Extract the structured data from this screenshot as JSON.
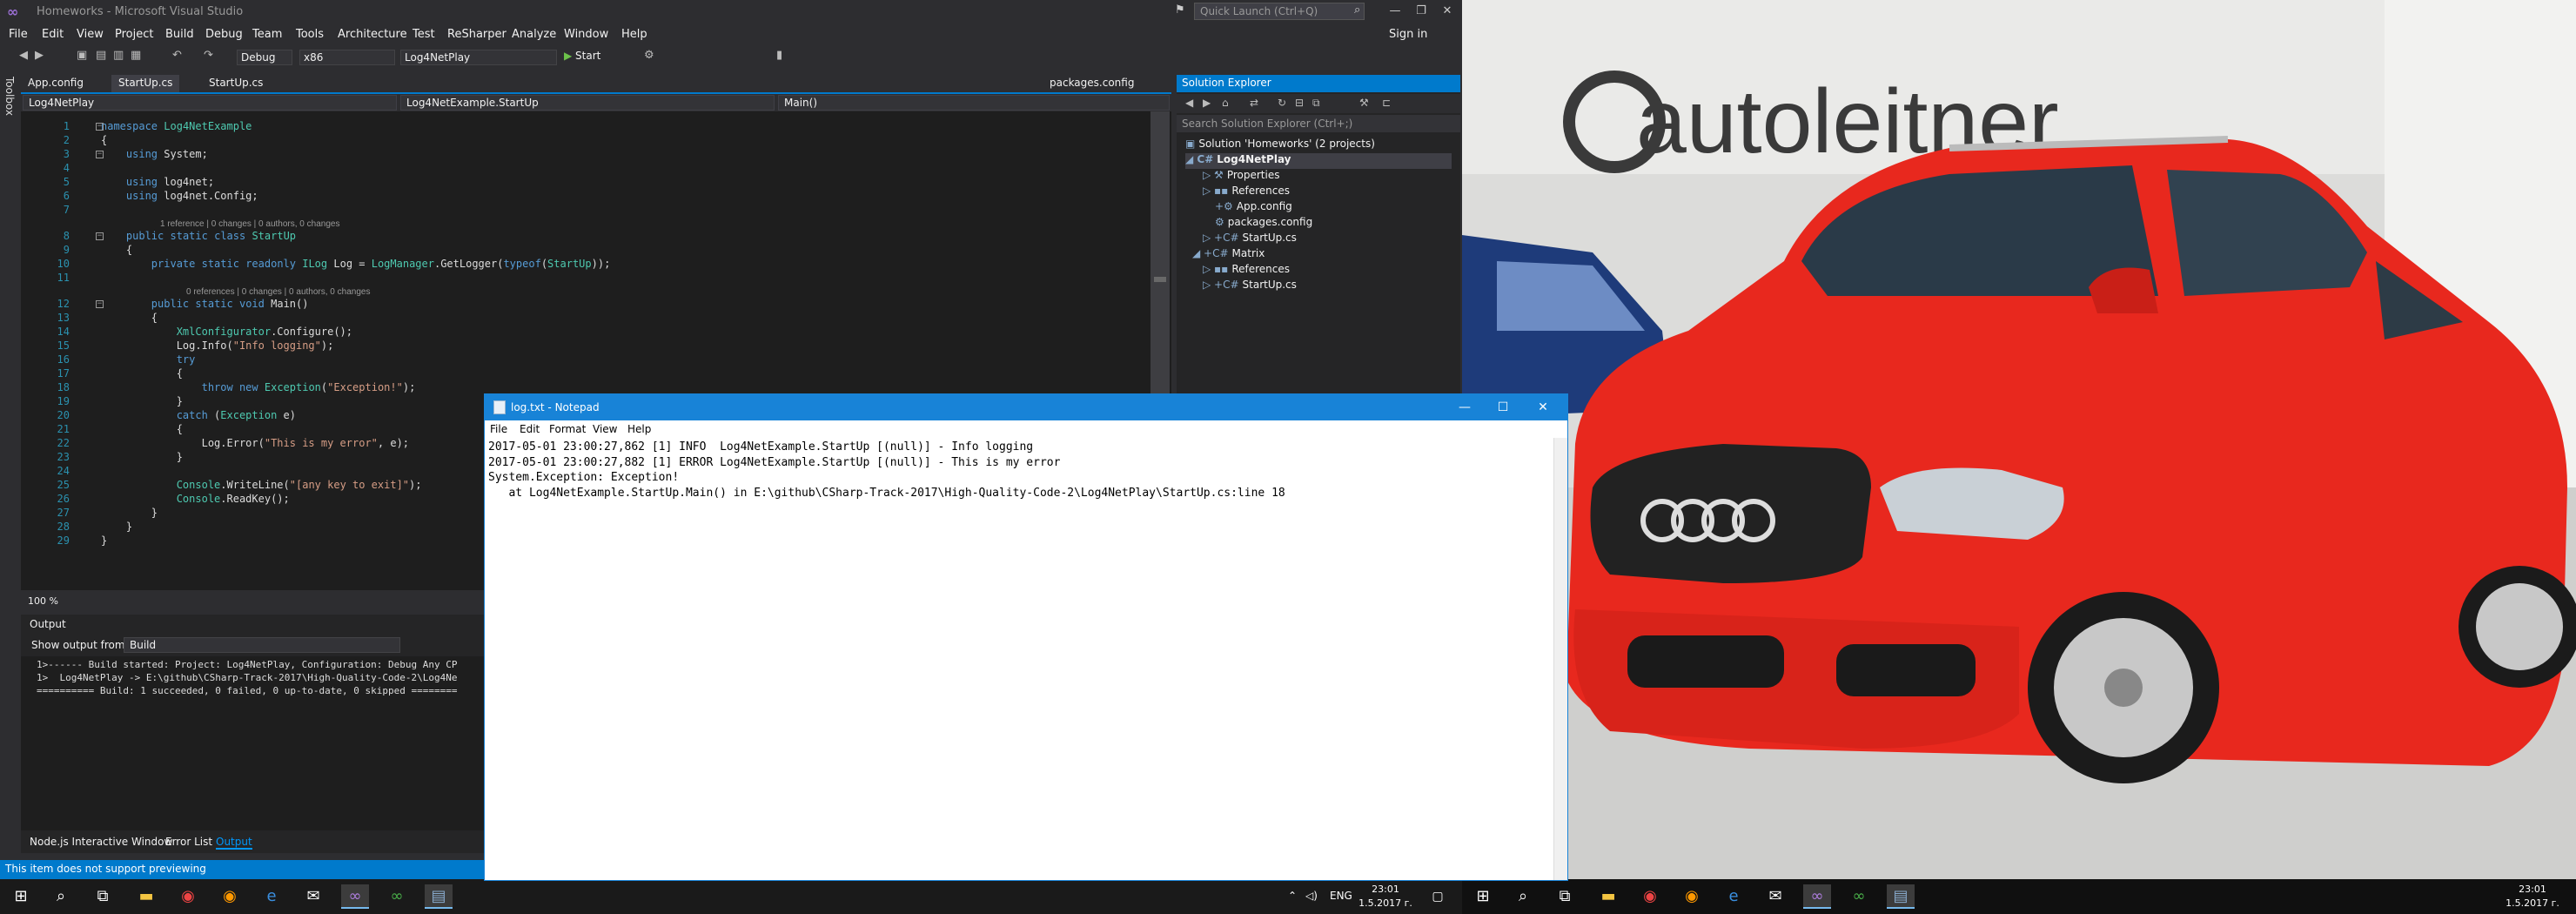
{
  "vs": {
    "title": "Homeworks - Microsoft Visual Studio",
    "quick_launch_placeholder": "Quick Launch (Ctrl+Q)",
    "sign_in": "Sign in",
    "menu": [
      "File",
      "Edit",
      "View",
      "Project",
      "Build",
      "Debug",
      "Team",
      "Tools",
      "Architecture",
      "Test",
      "ReSharper",
      "Analyze",
      "Window",
      "Help"
    ],
    "toolbar": {
      "config": "Debug",
      "platform": "x86",
      "startup_project": "Log4NetPlay",
      "start": "Start"
    },
    "toolbox_label": "Toolbox",
    "doc_tabs": [
      "App.config",
      "StartUp.cs",
      "StartUp.cs",
      "packages.config"
    ],
    "nav": {
      "project": "Log4NetPlay",
      "class": "Log4NetExample.StartUp",
      "member": "Main()"
    },
    "code_lines": [
      {
        "n": "1",
        "t": "namespace Log4NetExample"
      },
      {
        "n": "2",
        "t": "{"
      },
      {
        "n": "3",
        "t": "    using System;"
      },
      {
        "n": "4",
        "t": ""
      },
      {
        "n": "5",
        "t": "    using log4net;"
      },
      {
        "n": "6",
        "t": "    using log4net.Config;"
      },
      {
        "n": "7",
        "t": ""
      },
      {
        "n": "8",
        "t": "    public static class StartUp"
      },
      {
        "n": "9",
        "t": "    {"
      },
      {
        "n": "10",
        "t": "        private static readonly ILog Log = LogManager.GetLogger(typeof(StartUp));"
      },
      {
        "n": "11",
        "t": ""
      },
      {
        "n": "12",
        "t": "        public static void Main()"
      },
      {
        "n": "13",
        "t": "        {"
      },
      {
        "n": "14",
        "t": "            XmlConfigurator.Configure();"
      },
      {
        "n": "15",
        "t": "            Log.Info(\"Info logging\");"
      },
      {
        "n": "16",
        "t": "            try"
      },
      {
        "n": "17",
        "t": "            {"
      },
      {
        "n": "18",
        "t": "                throw new Exception(\"Exception!\");"
      },
      {
        "n": "19",
        "t": "            }"
      },
      {
        "n": "20",
        "t": "            catch (Exception e)"
      },
      {
        "n": "21",
        "t": "            {"
      },
      {
        "n": "22",
        "t": "                Log.Error(\"This is my error\", e);"
      },
      {
        "n": "23",
        "t": "            }"
      },
      {
        "n": "24",
        "t": ""
      },
      {
        "n": "25",
        "t": "            Console.WriteLine(\"[any key to exit]\");"
      },
      {
        "n": "26",
        "t": "            Console.ReadKey();"
      },
      {
        "n": "27",
        "t": "        }"
      },
      {
        "n": "28",
        "t": "    }"
      },
      {
        "n": "29",
        "t": "}"
      }
    ],
    "codelens": [
      "1 reference | 0 changes | 0 authors, 0 changes",
      "0 references | 0 changes | 0 authors, 0 changes"
    ],
    "zoom": "100 %",
    "output": {
      "title": "Output",
      "show_from_label": "Show output from:",
      "source": "Build",
      "text": "1>------ Build started: Project: Log4NetPlay, Configuration: Debug Any CP\n1>  Log4NetPlay -> E:\\github\\CSharp-Track-2017\\High-Quality-Code-2\\Log4Ne\n========== Build: 1 succeeded, 0 failed, 0 up-to-date, 0 skipped ========"
    },
    "bottom_tabs": [
      "Node.js Interactive Window",
      "Error List",
      "Output"
    ],
    "solution_explorer": {
      "title": "Solution Explorer",
      "search_placeholder": "Search Solution Explorer (Ctrl+;)",
      "nodes": [
        "Solution 'Homeworks' (2 projects)",
        "Log4NetPlay",
        "Properties",
        "References",
        "App.config",
        "packages.config",
        "StartUp.cs",
        "Matrix",
        "References",
        "StartUp.cs"
      ]
    },
    "status": "This item does not support previewing"
  },
  "notepad": {
    "title": "log.txt - Notepad",
    "menu": [
      "File",
      "Edit",
      "Format",
      "View",
      "Help"
    ],
    "text": "2017-05-01 23:00:27,862 [1] INFO  Log4NetExample.StartUp [(null)] - Info logging\n2017-05-01 23:00:27,882 [1] ERROR Log4NetExample.StartUp [(null)] - This is my error\nSystem.Exception: Exception!\n   at Log4NetExample.StartUp.Main() in E:\\github\\CSharp-Track-2017\\High-Quality-Code-2\\Log4NetPlay\\StartUp.cs:line 18"
  },
  "taskbar_left": {
    "tray_lang": "ENG",
    "time": "23:01",
    "date": "1.5.2017 г."
  },
  "taskbar_right": {
    "time": "23:01",
    "date": "1.5.2017 г."
  },
  "photo": {
    "brand_text": "autoleitner"
  },
  "colors": {
    "vs_accent": "#007acc",
    "notepad_title": "#1883d7",
    "car_red": "#e8281e"
  }
}
